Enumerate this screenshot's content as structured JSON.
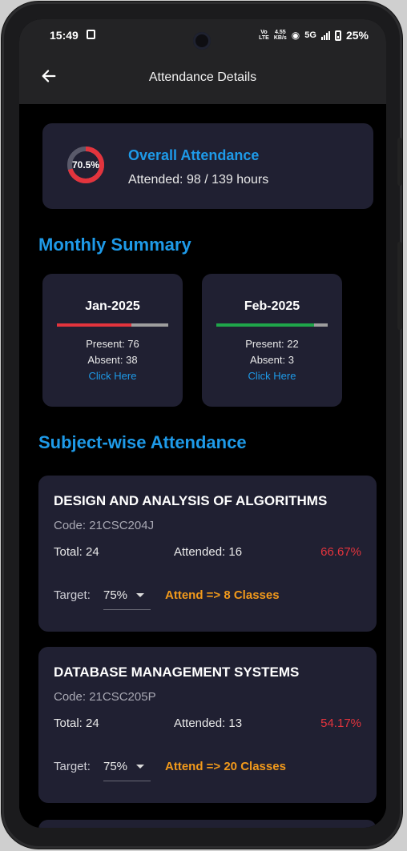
{
  "status_bar": {
    "time": "15:49",
    "network_label": "Voø\nLTE",
    "speed_value": "4.55",
    "speed_unit": "KB/s",
    "network_type": "5G",
    "battery": "25%"
  },
  "app_bar": {
    "title": "Attendance Details",
    "back_icon": "arrow-left-icon"
  },
  "overall": {
    "percent": 70.5,
    "percent_label": "70.5%",
    "title": "Overall Attendance",
    "attended_text": "Attended: 98 / 139 hours",
    "ring_color": "#e3343d",
    "ring_track_color": "#5a5a6a"
  },
  "monthly": {
    "section_title": "Monthly Summary",
    "months": [
      {
        "name": "Jan-2025",
        "present": "Present: 76",
        "absent": "Absent: 38",
        "link": "Click Here",
        "present_fraction": 0.667,
        "bar_color": "#e3343d"
      },
      {
        "name": "Feb-2025",
        "present": "Present: 22",
        "absent": "Absent: 3",
        "link": "Click Here",
        "present_fraction": 0.88,
        "bar_color": "#1fa64a"
      }
    ]
  },
  "subjects": {
    "section_title": "Subject-wise Attendance",
    "items": [
      {
        "name": "DESIGN AND ANALYSIS OF ALGORITHMS",
        "code": "Code: 21CSC204J",
        "total": "Total: 24",
        "attended": "Attended: 16",
        "percent": "66.67%",
        "target_label": "Target:",
        "target_value": "75%",
        "advice": "Attend => 8 Classes"
      },
      {
        "name": "DATABASE MANAGEMENT SYSTEMS",
        "code": "Code: 21CSC205P",
        "total": "Total: 24",
        "attended": "Attended: 13",
        "percent": "54.17%",
        "target_label": "Target:",
        "target_value": "75%",
        "advice": "Attend => 20 Classes"
      }
    ]
  },
  "colors": {
    "accent": "#1e9ae8",
    "card_bg": "#202032",
    "warning": "#f29a1b",
    "danger": "#e3343d"
  }
}
